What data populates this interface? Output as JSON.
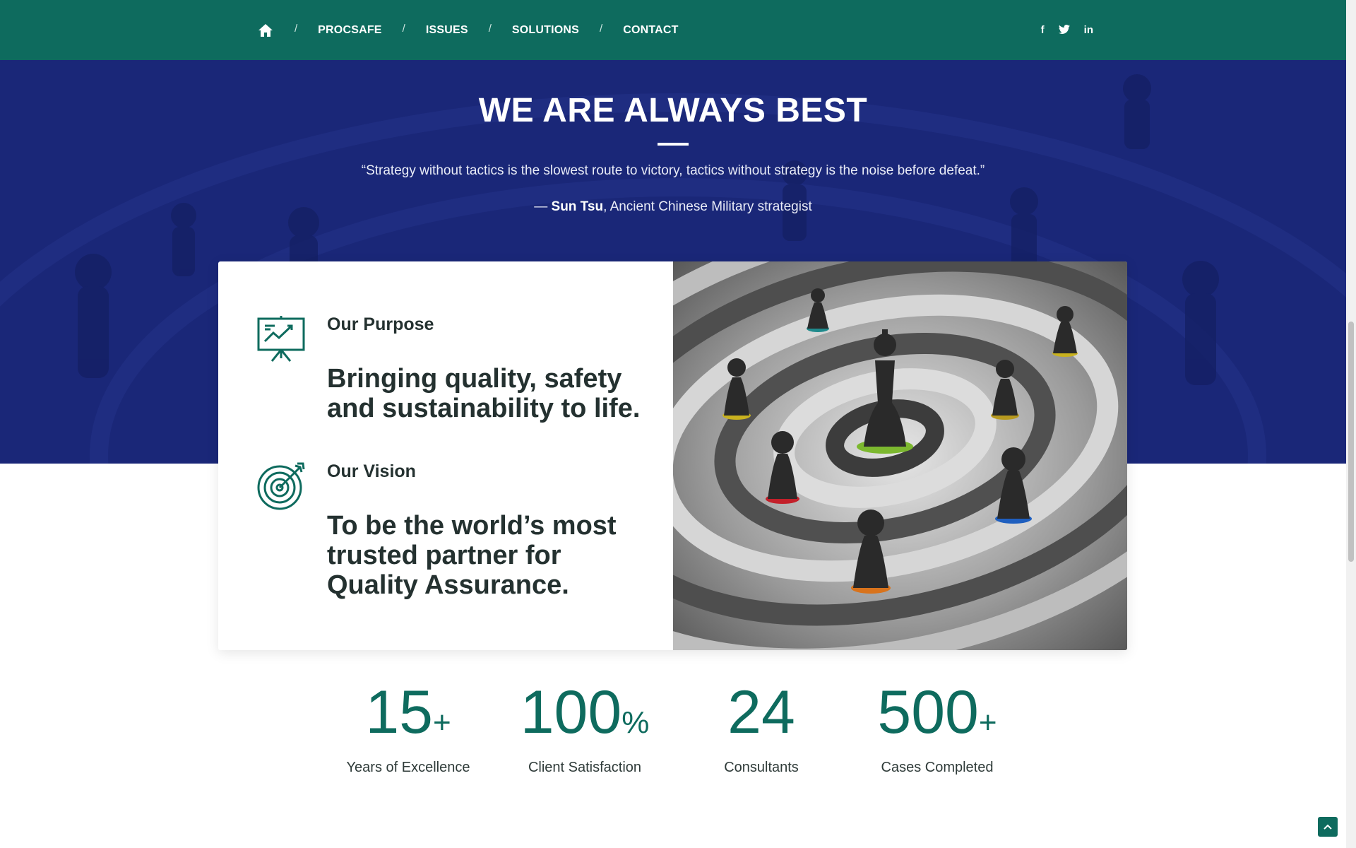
{
  "nav": {
    "home_icon": "home-icon",
    "separator": "/",
    "links": [
      "PROCSAFE",
      "ISSUES",
      "SOLUTIONS",
      "CONTACT"
    ],
    "social": {
      "facebook": "f",
      "twitter_icon": "twitter-icon",
      "linkedin": "in"
    },
    "color": "#0e6b5e"
  },
  "hero": {
    "title": "WE ARE ALWAYS BEST",
    "quote": "“Strategy without tactics is the slowest route to victory, tactics without strategy is the noise before defeat.”",
    "attribution_dash": "— ",
    "attribution_name": "Sun Tsu",
    "attribution_rest": ", Ancient Chinese Military strategist",
    "background_color": "#1a2778"
  },
  "card": {
    "purpose": {
      "icon": "presentation-chart-icon",
      "label": "Our Purpose",
      "text": "Bringing quality, safety and sustainability to life."
    },
    "vision": {
      "icon": "target-arrow-icon",
      "label": "Our Vision",
      "text": "To be the world’s most trusted partner for Quality Assurance."
    },
    "image": "chess-pieces-on-target-image"
  },
  "stats": [
    {
      "value": "15",
      "suffix": "+",
      "label": "Years of Excellence"
    },
    {
      "value": "100",
      "suffix": "%",
      "label": "Client Satisfaction"
    },
    {
      "value": "24",
      "suffix": "",
      "label": "Consultants"
    },
    {
      "value": "500",
      "suffix": "+",
      "label": "Cases Completed"
    }
  ],
  "back_to_top_icon": "chevron-up-icon",
  "accent_color": "#0e6b5e"
}
